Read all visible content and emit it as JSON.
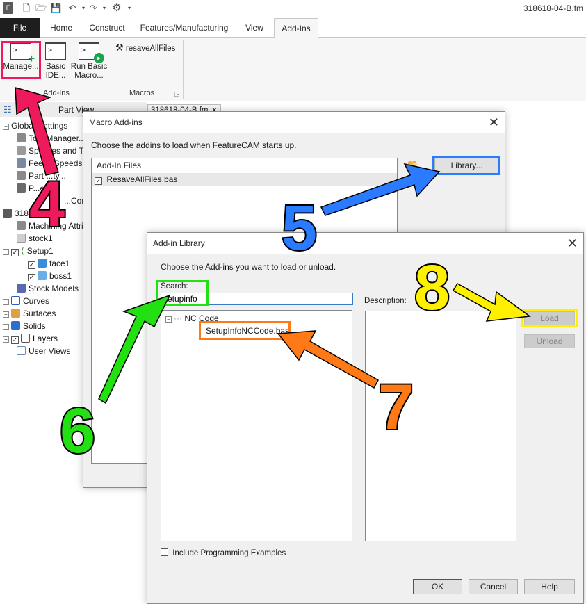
{
  "app": {
    "title": "318618-04-B.fm",
    "quick_access": [
      "app-logo-icon",
      "new-icon",
      "open-icon",
      "save-icon",
      "undo-icon",
      "redo-icon",
      "gear-icon"
    ]
  },
  "ribbon": {
    "tabs": [
      "File",
      "Home",
      "Construct",
      "Features/Manufacturing",
      "View",
      "Add-Ins"
    ],
    "active_tab": "Add-Ins",
    "buttons": {
      "manage": "Manage...",
      "basic_ide_line1": "Basic",
      "basic_ide_line2": "IDE...",
      "run_basic_line1": "Run Basic",
      "run_basic_line2": "Macro...",
      "resave": "resaveAllFiles"
    },
    "groups": {
      "addins": "Add-Ins",
      "macros": "Macros"
    }
  },
  "left_panel": {
    "header": "Part View",
    "items": [
      "Global Settings",
      "Tool Manager...",
      "Spindles and To",
      "Feeds/Speeds T",
      "Part ...ty...",
      "P...ess...",
      "...Confi",
      "318",
      "Machining Attribu",
      "stock1",
      "Setup1",
      "face1",
      "boss1",
      "Stock Models",
      "Curves",
      "Surfaces",
      "Solids",
      "Layers",
      "User Views"
    ]
  },
  "doc_tab": "318618-04-B.fm",
  "macro_dialog": {
    "title": "Macro Add-ins",
    "instruction": "Choose the addins to load when FeatureCAM starts up.",
    "list_header": "Add-In Files",
    "files": [
      "ResaveAllFiles.bas"
    ],
    "library_button": "Library..."
  },
  "library_dialog": {
    "title": "Add-in Library",
    "instruction": "Choose the Add-ins you want to load or unload.",
    "search_label": "Search:",
    "search_value": "setupinfo",
    "description_label": "Description:",
    "tree": {
      "category": "NC Code",
      "item": "SetupInfoNCCode.bas"
    },
    "load_button": "Load",
    "unload_button": "Unload",
    "include_examples": "Include Programming Examples",
    "ok_button": "OK",
    "cancel_button": "Cancel",
    "help_button": "Help"
  },
  "annotations": {
    "steps": [
      "4",
      "5",
      "6",
      "7",
      "8"
    ],
    "colors": {
      "step4": "#ee1a5b",
      "step5": "#2a7bff",
      "step6": "#22e011",
      "step7": "#ff7a16",
      "step8": "#fff000"
    }
  }
}
